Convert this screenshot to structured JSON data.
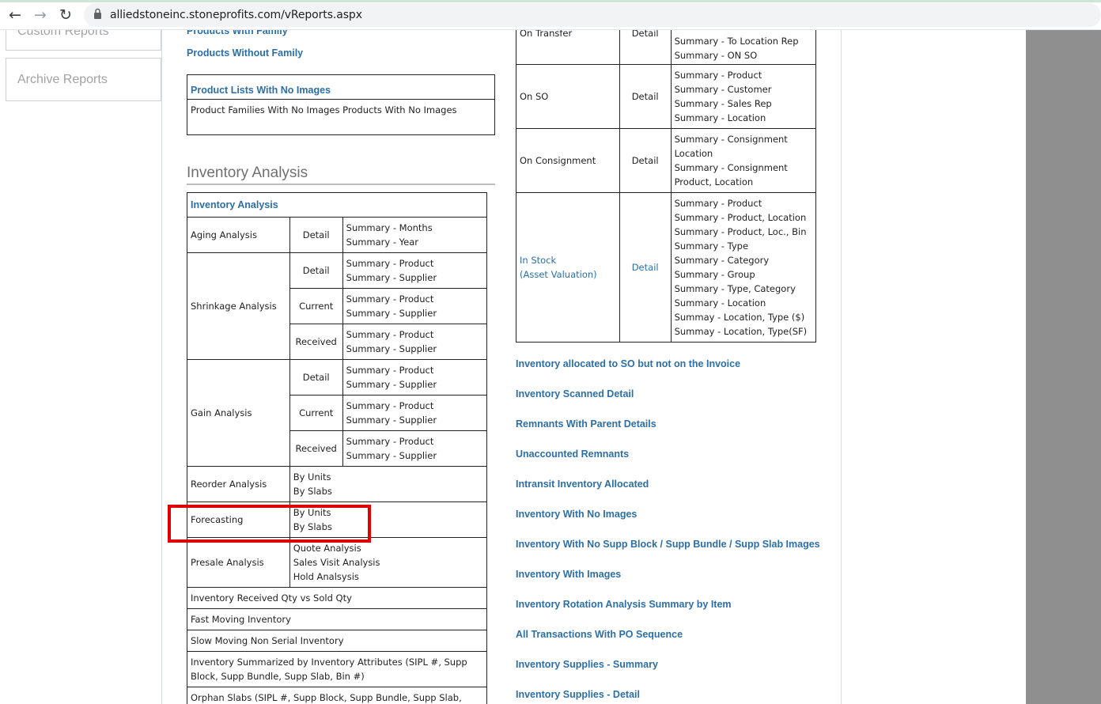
{
  "browser": {
    "url": "alliedstoneinc.stoneprofits.com/vReports.aspx"
  },
  "sidebar": {
    "custom_reports": "Custom Reports",
    "archive_reports": "Archive Reports"
  },
  "left": {
    "products_with_family": "Products With Family",
    "products_without_family": "Products Without Family",
    "no_images_box": {
      "header": "Product Lists With No Images",
      "items": [
        "Product Families With No Images",
        "Products With No Images"
      ]
    },
    "section_title": "Inventory Analysis",
    "table_header": "Inventory Analysis",
    "aging": {
      "label": "Aging Analysis",
      "type": "Detail",
      "summary": [
        "Summary - Months",
        "Summary - Year"
      ]
    },
    "shrinkage": {
      "label": "Shrinkage Analysis",
      "rows": [
        {
          "type": "Detail",
          "summary": [
            "Summary - Product",
            "Summary - Supplier"
          ]
        },
        {
          "type": "Current",
          "summary": [
            "Summary - Product",
            "Summary - Supplier"
          ]
        },
        {
          "type": "Received",
          "summary": [
            "Summary - Product",
            "Summary - Supplier"
          ]
        }
      ]
    },
    "gain": {
      "label": "Gain Analysis",
      "rows": [
        {
          "type": "Detail",
          "summary": [
            "Summary - Product",
            "Summary - Supplier"
          ]
        },
        {
          "type": "Current",
          "summary": [
            "Summary - Product",
            "Summary - Supplier"
          ]
        },
        {
          "type": "Received",
          "summary": [
            "Summary - Product",
            "Summary - Supplier"
          ]
        }
      ]
    },
    "reorder": {
      "label": "Reorder Analysis",
      "items": [
        "By Units",
        "By Slabs"
      ]
    },
    "forecasting": {
      "label": "Forecasting",
      "items": [
        "By Units",
        "By Slabs"
      ]
    },
    "presale": {
      "label": "Presale Analysis",
      "items": [
        "Quote Analysis",
        "Sales Visit Analysis",
        "Hold Analsysis"
      ]
    },
    "singles": [
      "Inventory Received Qty vs Sold Qty",
      "Fast Moving Inventory",
      "Slow Moving Non Serial Inventory",
      "Inventory Summarized by Inventory Attributes (SIPL #, Supp Block, Supp Bundle, Supp Slab, Bin #)",
      "Orphan Slabs (SIPL #, Supp Block, Supp Bundle, Supp Slab,"
    ]
  },
  "right": {
    "on_transfer": {
      "label": "On Transfer",
      "type": "Detail",
      "summary": [
        "Summary - To Location Rep",
        "Summary - ON SO"
      ]
    },
    "on_so": {
      "label": "On SO",
      "type": "Detail",
      "summary": [
        "Summary - Product",
        "Summary - Customer",
        "Summary - Sales Rep",
        "Summary - Location"
      ]
    },
    "on_consignment": {
      "label": "On Consignment",
      "type": "Detail",
      "summary": [
        "Summary - Consignment Location",
        "Summary - Consignment Product, Location"
      ]
    },
    "in_stock": {
      "label1": "In Stock",
      "label2": "(Asset Valuation)",
      "type": "Detail",
      "summary": [
        "Summary - Product",
        "Summary - Product, Location",
        "Summary - Product, Loc., Bin",
        "Summary - Type",
        "Summary - Category",
        "Summary - Group",
        "Summary - Type, Category",
        "Summary - Location",
        "Summay - Location, Type ($)",
        "Summay - Location, Type(SF)"
      ]
    },
    "links": [
      "Inventory allocated to SO but not on the Invoice",
      "Inventory Scanned Detail",
      "Remnants With Parent Details",
      "Unaccounted Remnants",
      "Intransit Inventory Allocated",
      "Inventory With No Images",
      "Inventory With No Supp Block / Supp Bundle / Supp Slab Images",
      "Inventory With Images",
      "Inventory Rotation Analysis Summary by Item",
      "All Transactions With PO Sequence",
      "Inventory Supplies - Summary",
      "Inventory Supplies - Detail"
    ]
  },
  "colors": {
    "link": "#2c6fa6",
    "highlight": "#e00000",
    "scrollbar_band": "#8f8f8f"
  }
}
